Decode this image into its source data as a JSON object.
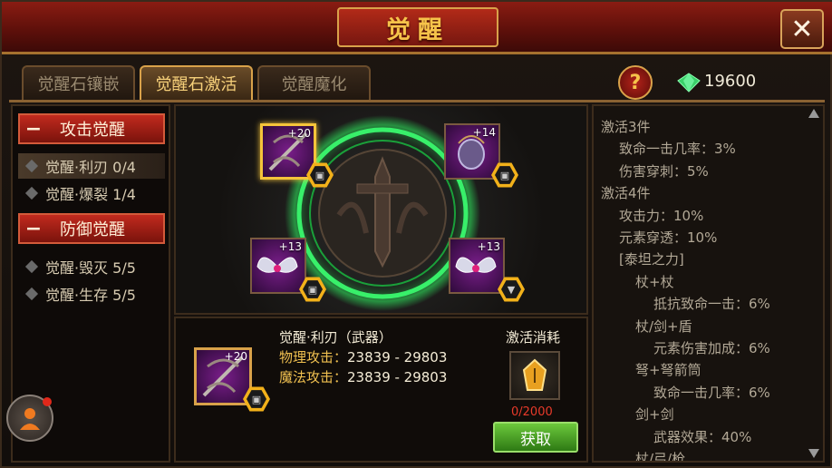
{
  "header": {
    "title": "觉醒"
  },
  "tabs": [
    {
      "label": "觉醒石镶嵌",
      "active": false
    },
    {
      "label": "觉醒石激活",
      "active": true
    },
    {
      "label": "觉醒魔化",
      "active": false
    }
  ],
  "currency": {
    "icon": "green-gem-icon",
    "amount": "19600"
  },
  "help": {
    "label": "?"
  },
  "close": {
    "label": "✕"
  },
  "sidebar": {
    "groups": [
      {
        "title": "攻击觉醒",
        "items": [
          {
            "label": "觉醒·利刃 0/4",
            "active": true
          },
          {
            "label": "觉醒·爆裂 1/4",
            "active": false
          }
        ]
      },
      {
        "title": "防御觉醒",
        "items": [
          {
            "label": "觉醒·毁灭 5/5",
            "active": false
          },
          {
            "label": "觉醒·生存 5/5",
            "active": false
          }
        ]
      }
    ]
  },
  "slots": [
    {
      "name": "crossbow-slot",
      "plus": "+20",
      "selected": true
    },
    {
      "name": "helmet-slot",
      "plus": "+14",
      "selected": false
    },
    {
      "name": "wings-slot-left",
      "plus": "+13",
      "selected": false
    },
    {
      "name": "wings-slot-right",
      "plus": "+13",
      "selected": false
    }
  ],
  "detail": {
    "plus": "+20",
    "name": "觉醒·利刃（武器）",
    "physical_label": "物理攻击：",
    "physical_value": "23839 - 29803",
    "magic_label": "魔法攻击：",
    "magic_value": "23839 - 29803",
    "cost_label": "激活消耗",
    "cost_count": "0/2000",
    "get_button": "获取"
  },
  "effects": [
    {
      "text": "激活3件",
      "indent": 0
    },
    {
      "text": "致命一击几率：3%",
      "indent": 1
    },
    {
      "text": "伤害穿刺：5%",
      "indent": 1
    },
    {
      "text": "激活4件",
      "indent": 0
    },
    {
      "text": "攻击力：10%",
      "indent": 1
    },
    {
      "text": "元素穿透：10%",
      "indent": 1
    },
    {
      "text": "[泰坦之力]",
      "indent": 1
    },
    {
      "text": "杖+杖",
      "indent": 2
    },
    {
      "text": "抵抗致命一击：6%",
      "indent": 3
    },
    {
      "text": "杖/剑+盾",
      "indent": 2
    },
    {
      "text": "元素伤害加成：6%",
      "indent": 3
    },
    {
      "text": "弩+弩箭筒",
      "indent": 2
    },
    {
      "text": "致命一击几率：6%",
      "indent": 3
    },
    {
      "text": "剑+剑",
      "indent": 2
    },
    {
      "text": "武器效果：40%",
      "indent": 3
    },
    {
      "text": "杖/弓/枪",
      "indent": 2
    }
  ],
  "colors": {
    "accent": "#f5c43a",
    "circle_glow": "#2ee05a",
    "red_header": "#c12a1e"
  }
}
